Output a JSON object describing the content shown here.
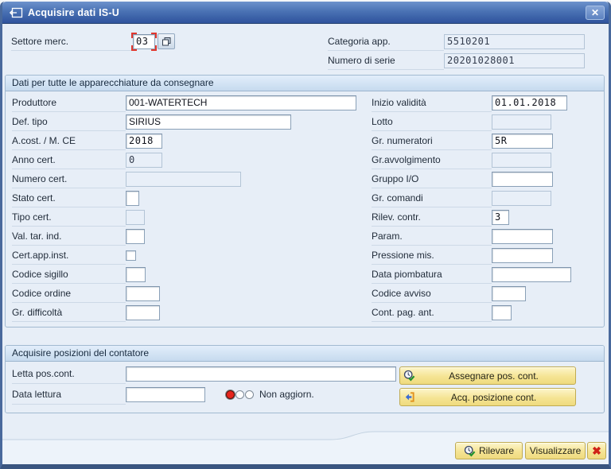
{
  "window": {
    "title": "Acquisire dati IS-U"
  },
  "icons": {
    "close": "✕",
    "cancel_x": "✖"
  },
  "top": {
    "settore_merc": {
      "label": "Settore merc.",
      "value": "03"
    },
    "categoria_app": {
      "label": "Categoria app.",
      "value": "5510201"
    },
    "numero_serie": {
      "label": "Numero di serie",
      "value": "20201028001"
    }
  },
  "group1": {
    "title": "Dati per tutte le apparecchiature da consegnare",
    "left": [
      {
        "label": "Produttore",
        "value": "001-WATERTECH"
      },
      {
        "label": "Def. tipo",
        "value": "SIRIUS"
      },
      {
        "label": "A.cost. / M. CE",
        "value": "2018"
      },
      {
        "label": "Anno cert.",
        "value": "0"
      },
      {
        "label": "Numero cert.",
        "value": ""
      },
      {
        "label": "Stato cert.",
        "value": ""
      },
      {
        "label": "Tipo cert.",
        "value": ""
      },
      {
        "label": "Val. tar. ind.",
        "value": ""
      },
      {
        "label": "Cert.app.inst.",
        "value": ""
      },
      {
        "label": "Codice sigillo",
        "value": ""
      },
      {
        "label": "Codice ordine",
        "value": ""
      },
      {
        "label": "Gr. difficoltà",
        "value": ""
      }
    ],
    "right": [
      {
        "label": "Inizio validità",
        "value": "01.01.2018"
      },
      {
        "label": "Lotto",
        "value": ""
      },
      {
        "label": "Gr. numeratori",
        "value": "5R"
      },
      {
        "label": "Gr.avvolgimento",
        "value": ""
      },
      {
        "label": "Gruppo I/O",
        "value": ""
      },
      {
        "label": "Gr. comandi",
        "value": ""
      },
      {
        "label": "Rilev. contr.",
        "value": "3"
      },
      {
        "label": "Param.",
        "value": ""
      },
      {
        "label": "Pressione mis.",
        "value": ""
      },
      {
        "label": "Data piombatura",
        "value": ""
      },
      {
        "label": "Codice avviso",
        "value": ""
      },
      {
        "label": "Cont. pag. ant.",
        "value": ""
      }
    ]
  },
  "group2": {
    "title": "Acquisire posizioni del contatore",
    "letta_pos": {
      "label": "Letta pos.cont.",
      "value": ""
    },
    "data_lettura": {
      "label": "Data lettura",
      "value": ""
    },
    "status_text": "Non aggiorn.",
    "buttons": {
      "assegnare": "Assegnare pos. cont.",
      "acquisire": "Acq. posizione cont."
    }
  },
  "footer": {
    "rilevare": "Rilevare",
    "visualizzare": "Visualizzare"
  },
  "colors": {
    "titlebar_top": "#6d92cc",
    "titlebar_bottom": "#2f539d",
    "dialog_bg": "#e7eef7",
    "button_yellow": "#f5e494",
    "status_red": "#e6251d"
  }
}
